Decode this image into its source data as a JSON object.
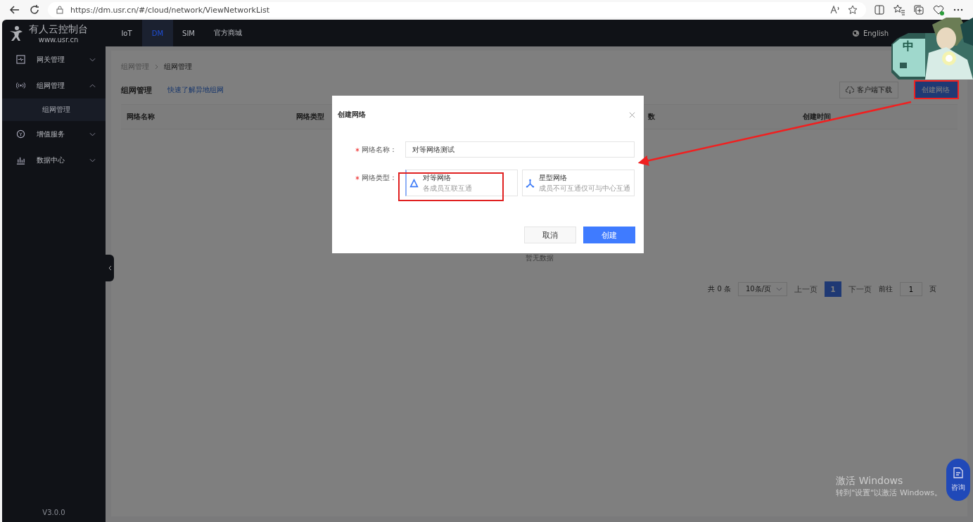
{
  "browser": {
    "url": "https://dm.usr.cn/#/cloud/network/ViewNetworkList"
  },
  "logo": {
    "title": "有人云控制台",
    "subtitle": "www.usr.cn"
  },
  "nav_tabs": [
    {
      "label": "IoT",
      "selected": false
    },
    {
      "label": "DM",
      "selected": true
    },
    {
      "label": "SIM",
      "selected": false
    },
    {
      "label": "官方商城",
      "selected": false
    }
  ],
  "language": "English",
  "floating_widget": {
    "kind": "picture",
    "label": "中"
  },
  "sidebar": {
    "items": [
      {
        "label": "网关管理",
        "expanded": false
      },
      {
        "label": "组网管理",
        "expanded": true,
        "children": [
          {
            "label": "组网管理",
            "selected": true
          }
        ]
      },
      {
        "label": "增值服务",
        "expanded": false
      },
      {
        "label": "数据中心",
        "expanded": false
      }
    ],
    "version": "V3.0.0"
  },
  "breadcrumb": [
    "组网管理",
    "组网管理"
  ],
  "page_title": "组网管理",
  "help_link": "快速了解异地组网",
  "toolbar_buttons": [
    {
      "label": "客户端下载",
      "kind": "download"
    },
    {
      "label": "创建网络",
      "kind": "primary"
    }
  ],
  "table": {
    "columns": [
      "网络名称",
      "网络类型",
      "数",
      "创建时间"
    ],
    "empty_text": "暂无数据"
  },
  "pagination": {
    "total": "共 0 条",
    "page_size": "10条/页",
    "prev": "上一页",
    "pages": [
      {
        "label": "1",
        "selected": true
      }
    ],
    "next": "下一页",
    "goto_label": "前往",
    "goto_value": "1",
    "goto_suffix": "页"
  },
  "consult_button": "咨询",
  "activation_notice": {
    "title": "激活 Windows",
    "text": "转到\"设置\"以激活 Windows。"
  },
  "dialog": {
    "title": "创建网络",
    "fields": [
      {
        "label": "网络名称：",
        "required": true,
        "value": "对等网络测试"
      }
    ],
    "type_label": "网络类型：",
    "type_required": true,
    "types": [
      {
        "name": "对等网络",
        "description": "各成员互联互通",
        "selected": true
      },
      {
        "name": "星型网络",
        "description": "成员不可互通仅可与中心互通",
        "selected": false
      }
    ],
    "buttons": [
      {
        "label": "取消",
        "kind": "secondary"
      },
      {
        "label": "创建",
        "kind": "primary"
      }
    ]
  }
}
